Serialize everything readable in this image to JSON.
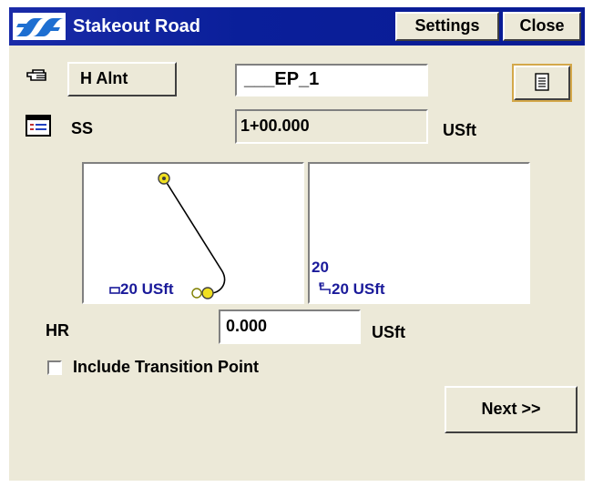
{
  "titlebar": {
    "title": "Stakeout Road",
    "logo_icon": "app-logo-icon",
    "settings_label": "Settings",
    "close_label": "Close",
    "background_color": "#0a1f9a"
  },
  "alignment": {
    "button_label": "H Alnt",
    "name_value": "___EP_1",
    "pointer_icon": "hand-pointer-icon",
    "options_icon": "document-icon"
  },
  "station": {
    "label": "SS",
    "value": "1+00.000",
    "unit": "USft",
    "icon": "list-icon"
  },
  "plan_view": {
    "scale_label": "20 USft",
    "scale_icon": "scale-bar-icon"
  },
  "profile_view": {
    "top_value": "20",
    "scale_label": "20 USft",
    "scale_icon": "scale-bar-icon"
  },
  "hr": {
    "label": "HR",
    "value": "0.000",
    "unit": "USft"
  },
  "transition": {
    "checkbox_label": "Include Transition Point",
    "checked": false
  },
  "footer": {
    "next_label": "Next >>"
  }
}
